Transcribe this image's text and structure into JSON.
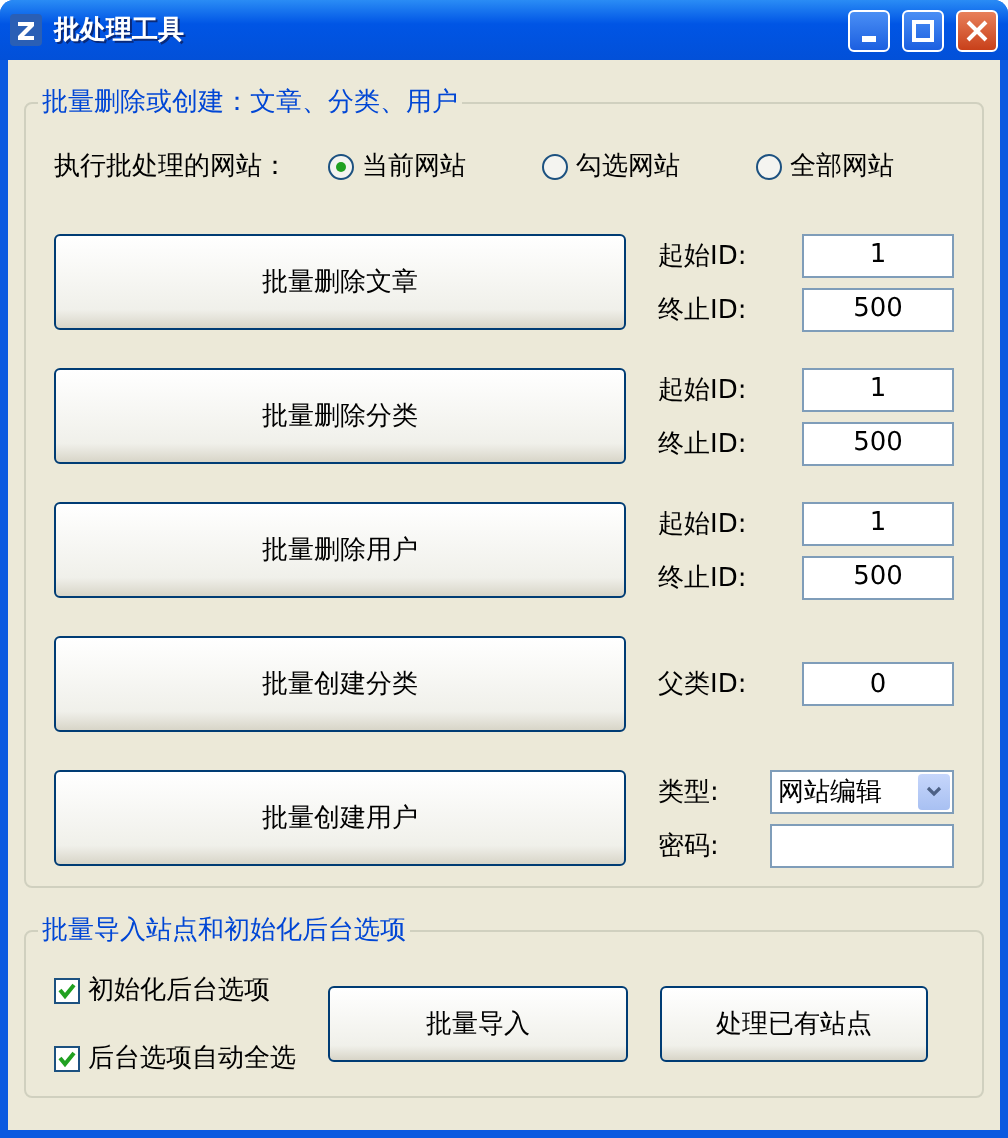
{
  "window": {
    "title": "批处理工具"
  },
  "batch_group": {
    "legend": "批量删除或创建：文章、分类、用户",
    "site_label": "执行批处理的网站：",
    "site_options": [
      {
        "label": "当前网站",
        "selected": true
      },
      {
        "label": "勾选网站",
        "selected": false
      },
      {
        "label": "全部网站",
        "selected": false
      }
    ],
    "actions": [
      {
        "kind": "range",
        "button": "批量删除文章",
        "fields": [
          {
            "label": "起始ID:",
            "value": "1"
          },
          {
            "label": "终止ID:",
            "value": "500"
          }
        ]
      },
      {
        "kind": "range",
        "button": "批量删除分类",
        "fields": [
          {
            "label": "起始ID:",
            "value": "1"
          },
          {
            "label": "终止ID:",
            "value": "500"
          }
        ]
      },
      {
        "kind": "range",
        "button": "批量删除用户",
        "fields": [
          {
            "label": "起始ID:",
            "value": "1"
          },
          {
            "label": "终止ID:",
            "value": "500"
          }
        ]
      },
      {
        "kind": "parent",
        "button": "批量创建分类",
        "fields": [
          {
            "label": "父类ID:",
            "value": "0"
          }
        ]
      },
      {
        "kind": "user",
        "button": "批量创建用户",
        "fields": [
          {
            "label": "类型:",
            "value": "网站编辑"
          },
          {
            "label": "密码:"
          }
        ]
      }
    ]
  },
  "import_group": {
    "legend": "批量导入站点和初始化后台选项",
    "checkboxes": [
      {
        "label": "初始化后台选项",
        "checked": true
      },
      {
        "label": "后台选项自动全选",
        "checked": true
      }
    ],
    "buttons": [
      "批量导入",
      "处理已有站点"
    ]
  }
}
